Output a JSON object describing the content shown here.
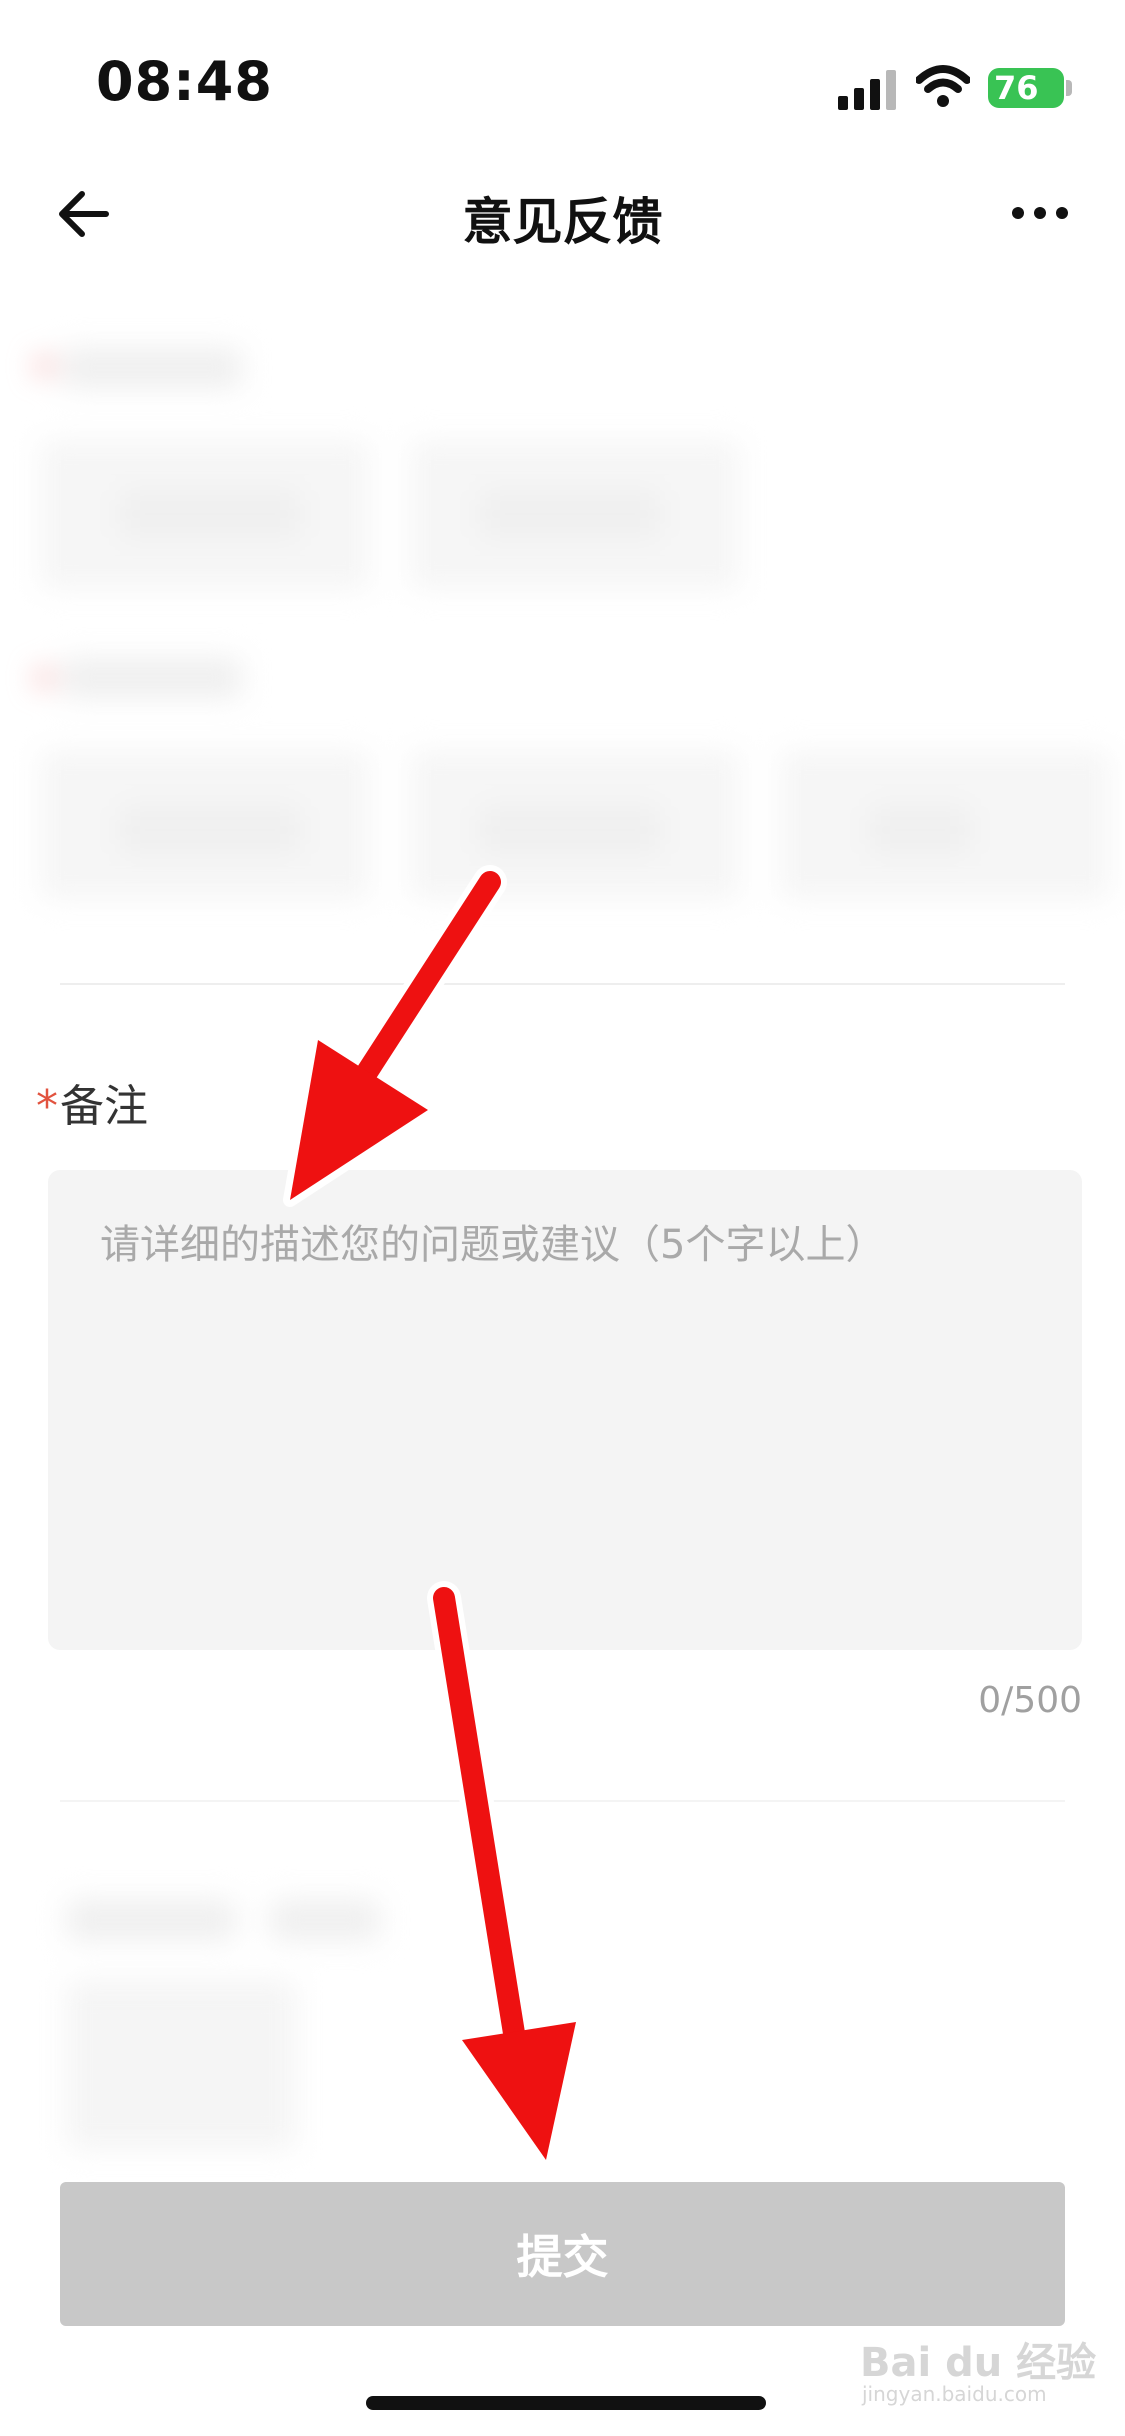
{
  "status_bar": {
    "time": "08:48",
    "battery": "76",
    "icons": [
      "signal-icon",
      "wifi-icon",
      "battery-icon"
    ]
  },
  "nav": {
    "title": "意见反馈",
    "back_icon": "back-arrow-icon",
    "more_icon": "more-icon"
  },
  "form": {
    "remark_required_mark": "*",
    "remark_label": "备注",
    "remark_value": "",
    "remark_placeholder": "请详细的描述您的问题或建议（5个字以上）",
    "counter": "0/500"
  },
  "submit_label": "提交",
  "watermark": {
    "brand": "Bai du 经验",
    "url": "jingyan.baidu.com"
  },
  "colors": {
    "required": "#e2533f",
    "battery": "#39c354",
    "submit_disabled": "#c8c8c8",
    "annotation_arrow": "#ee1111"
  }
}
